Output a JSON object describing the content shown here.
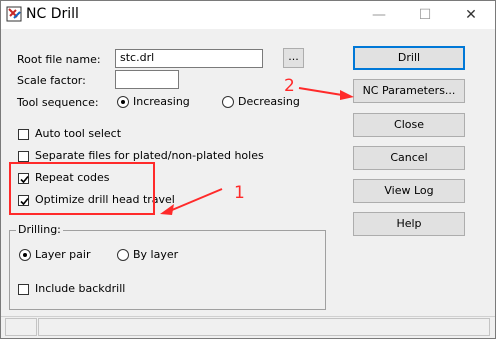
{
  "window": {
    "title": "NC Drill",
    "minimize_glyph": "—",
    "maximize_glyph": "☐",
    "close_glyph": "✕",
    "icon": "nc-drill-app-icon"
  },
  "form": {
    "root_file_label": "Root file name:",
    "root_file_value": "stc.drl",
    "browse_label": "...",
    "scale_factor_label": "Scale factor:",
    "scale_factor_value": "",
    "tool_sequence_label": "Tool sequence:",
    "tool_sequence_options": [
      {
        "label": "Increasing",
        "selected": true
      },
      {
        "label": "Decreasing",
        "selected": false
      }
    ],
    "checkboxes": [
      {
        "label": "Auto tool select",
        "checked": false
      },
      {
        "label": "Separate files for plated/non-plated holes",
        "checked": false
      },
      {
        "label": "Repeat codes",
        "checked": true
      },
      {
        "label": "Optimize drill head travel",
        "checked": true
      }
    ]
  },
  "drilling": {
    "group_label": "Drilling:",
    "options": [
      {
        "label": "Layer pair",
        "selected": true
      },
      {
        "label": "By layer",
        "selected": false
      }
    ],
    "include_backdrill_label": "Include backdrill",
    "include_backdrill_checked": false
  },
  "buttons": {
    "drill": "Drill",
    "nc_parameters": "NC Parameters...",
    "close": "Close",
    "cancel": "Cancel",
    "view_log": "View Log",
    "help": "Help"
  },
  "annotations": {
    "label_1": "1",
    "label_2": "2",
    "color": "#ff2a2a"
  }
}
